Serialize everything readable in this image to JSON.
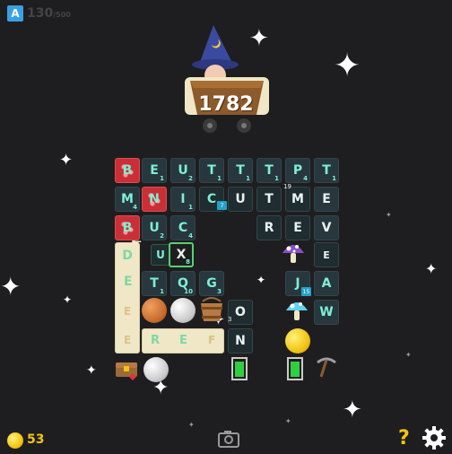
{
  "header": {
    "app_badge": "A",
    "faded_counter": "130",
    "faded_suffix": "/500"
  },
  "score": {
    "value": "1782"
  },
  "board": {
    "row1": [
      {
        "letter": "B",
        "sub": ""
      },
      {
        "letter": "E",
        "sub": "1"
      },
      {
        "letter": "U",
        "sub": "2"
      },
      {
        "letter": "T",
        "sub": "1"
      },
      {
        "letter": "T",
        "sub": "1"
      },
      {
        "letter": "T",
        "sub": "1"
      },
      {
        "letter": "P",
        "sub": "4"
      },
      {
        "letter": "T",
        "sub": "1"
      }
    ],
    "row2": [
      {
        "letter": "M",
        "sub": "4"
      },
      {
        "letter": "N",
        "sub": ""
      },
      {
        "letter": "I",
        "sub": "1"
      },
      {
        "letter": "C",
        "sub": ""
      },
      {
        "letter": "U",
        "sub": ""
      },
      {
        "letter": "T",
        "sub": ""
      },
      {
        "letter": "M",
        "sub": ""
      },
      {
        "letter": "E",
        "sub": ""
      }
    ],
    "row2_badges": {
      "c_badge": "7",
      "m_badge": "19"
    },
    "row3": [
      {
        "letter": "B",
        "sub": ""
      },
      {
        "letter": "U",
        "sub": "2"
      },
      {
        "letter": "C",
        "sub": "4"
      },
      {
        "letter": "R",
        "sub": ""
      },
      {
        "letter": "E",
        "sub": ""
      },
      {
        "letter": "V",
        "sub": ""
      }
    ],
    "row4": [
      {
        "letter": "D",
        "sub": ""
      },
      {
        "letter": "U",
        "sub": ""
      },
      {
        "letter": "X",
        "sub": "8"
      },
      {
        "letter": "E",
        "sub": ""
      }
    ],
    "row5": [
      {
        "letter": "E",
        "sub": ""
      },
      {
        "letter": "T",
        "sub": "1"
      },
      {
        "letter": "Q",
        "sub": "10"
      },
      {
        "letter": "G",
        "sub": "3"
      },
      {
        "letter": "J",
        "sub": ""
      },
      {
        "letter": "A",
        "sub": ""
      }
    ],
    "row5_badges": {
      "j_badge": "15"
    },
    "row6": [
      {
        "letter": "E",
        "sub": ""
      },
      {
        "letter": "O",
        "sub": ""
      },
      {
        "letter": "W",
        "sub": ""
      }
    ],
    "row6_badges": {
      "o_badge": "3"
    },
    "row7": [
      {
        "letter": "E",
        "sub": ""
      },
      {
        "letter": "R",
        "sub": ""
      },
      {
        "letter": "E",
        "sub": ""
      },
      {
        "letter": "F",
        "sub": ""
      },
      {
        "letter": "N",
        "sub": ""
      }
    ]
  },
  "footer": {
    "coins": "53",
    "help_label": "?",
    "icons": [
      "coin-icon",
      "camera-icon",
      "help-icon",
      "settings-icon"
    ]
  },
  "colors": {
    "background": "#1e1e20",
    "tile": "#27373d",
    "letter": "#7ef0d4",
    "red_tile": "#c92f36",
    "cream_tile": "#efe7c5",
    "coin": "#f3c414"
  }
}
